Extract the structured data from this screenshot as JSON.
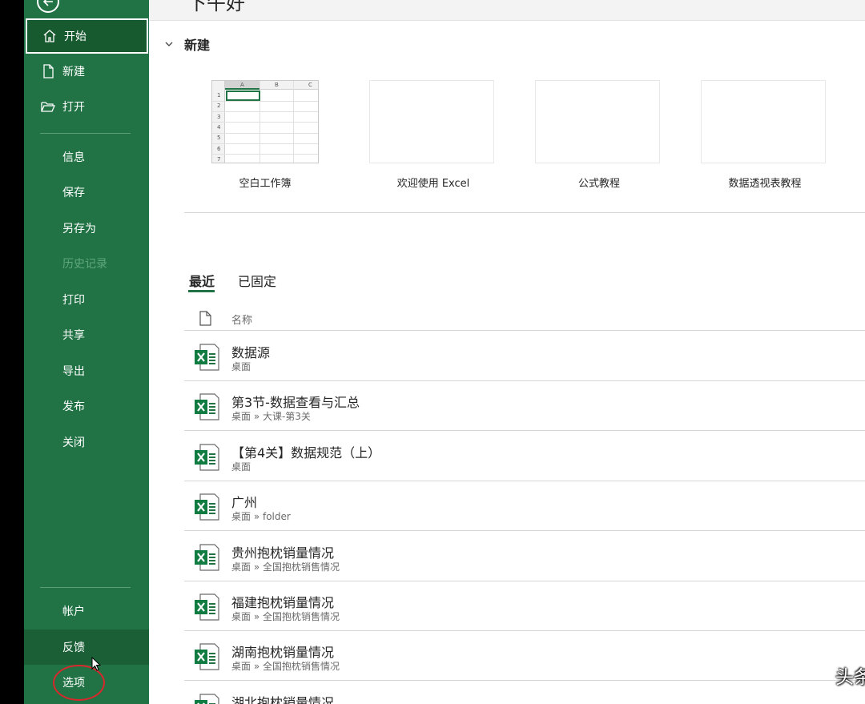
{
  "greeting": "下午好",
  "sidebar": {
    "top_items": [
      {
        "label": "开始",
        "icon": "home-icon"
      },
      {
        "label": "新建",
        "icon": "new-document-icon"
      },
      {
        "label": "打开",
        "icon": "folder-open-icon"
      }
    ],
    "items": [
      {
        "label": "信息"
      },
      {
        "label": "保存"
      },
      {
        "label": "另存为"
      },
      {
        "label": "历史记录",
        "disabled": true
      },
      {
        "label": "打印"
      },
      {
        "label": "共享"
      },
      {
        "label": "导出"
      },
      {
        "label": "发布"
      },
      {
        "label": "关闭"
      }
    ],
    "bottom_items": [
      {
        "label": "帐户"
      },
      {
        "label": "反馈"
      },
      {
        "label": "选项"
      }
    ]
  },
  "new_section": {
    "title": "新建",
    "templates": [
      {
        "label": "空白工作簿"
      },
      {
        "label": "欢迎使用 Excel"
      },
      {
        "label": "公式教程"
      },
      {
        "label": "数据透视表教程"
      }
    ],
    "grid": {
      "columns": [
        "A",
        "B",
        "C"
      ],
      "rows": [
        "1",
        "2",
        "3",
        "4",
        "5",
        "6",
        "7"
      ]
    }
  },
  "tabs": {
    "recent": "最近",
    "pinned": "已固定"
  },
  "list": {
    "name_header": "名称",
    "files": [
      {
        "name": "数据源",
        "path": "桌面"
      },
      {
        "name": "第3节-数据查看与汇总",
        "path": "桌面 » 大课-第3关"
      },
      {
        "name": "【第4关】数据规范（上）",
        "path": "桌面"
      },
      {
        "name": "广州",
        "path": "桌面 » folder"
      },
      {
        "name": "贵州抱枕销量情况",
        "path": "桌面 » 全国抱枕销售情况"
      },
      {
        "name": "福建抱枕销量情况",
        "path": "桌面 » 全国抱枕销售情况"
      },
      {
        "name": "湖南抱枕销量情况",
        "path": "桌面 » 全国抱枕销售情况"
      },
      {
        "name": "湖北抱枕销量情况",
        "path": ""
      }
    ]
  },
  "watermark": "头条 @胖达叠丝",
  "colors": {
    "sidebar_green": "#217346",
    "active_green": "#185a30",
    "highlight_red": "#d8282c"
  }
}
